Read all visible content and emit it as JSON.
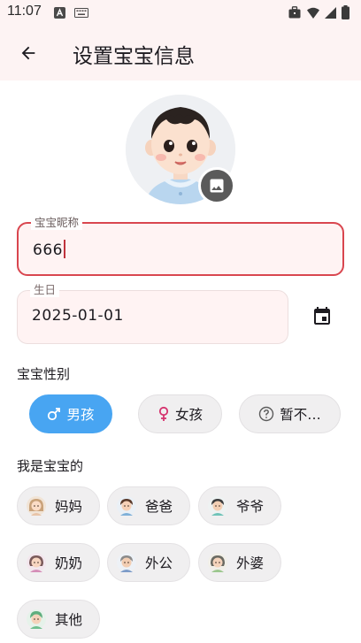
{
  "status_bar": {
    "time": "11:07"
  },
  "app_bar": {
    "title": "设置宝宝信息"
  },
  "nickname": {
    "label": "宝宝昵称",
    "value": "666"
  },
  "birthday": {
    "label": "生日",
    "value": "2025-01-01"
  },
  "gender": {
    "title": "宝宝性别",
    "options": [
      {
        "label": "男孩",
        "icon": "male-icon",
        "selected": true
      },
      {
        "label": "女孩",
        "icon": "female-icon",
        "selected": false
      },
      {
        "label": "暂不…",
        "icon": "help-icon",
        "selected": false
      }
    ]
  },
  "relation": {
    "title": "我是宝宝的",
    "options": [
      {
        "label": "妈妈",
        "icon": "mother-avatar-icon"
      },
      {
        "label": "爸爸",
        "icon": "father-avatar-icon"
      },
      {
        "label": "爷爷",
        "icon": "grandpa-avatar-icon"
      },
      {
        "label": "奶奶",
        "icon": "grandma-avatar-icon"
      },
      {
        "label": "外公",
        "icon": "maternal-grandpa-avatar-icon"
      },
      {
        "label": "外婆",
        "icon": "maternal-grandma-avatar-icon"
      },
      {
        "label": "其他",
        "icon": "other-avatar-icon"
      }
    ]
  },
  "colors": {
    "accent": "#48a5f2",
    "error": "#d9464f",
    "header_bg": "#fdf3f3"
  }
}
